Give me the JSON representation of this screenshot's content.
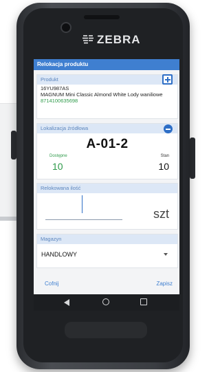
{
  "brand": {
    "logo_text": "ZEBRA"
  },
  "app": {
    "title": "Relokacja produktu"
  },
  "product": {
    "header": "Produkt",
    "code": "16YU987AS",
    "name": "MAGNUM Mini Classic Almond White Lody waniliowe",
    "ean": "8714100635698",
    "add_icon": "plus-square-icon"
  },
  "source_location": {
    "header": "Lokalizacja źródłowa",
    "code": "A-01-2",
    "available_label": "Dostępne",
    "available_value": "10",
    "stock_label": "Stan",
    "stock_value": "10",
    "collapse_icon": "minus-circle-icon"
  },
  "quantity": {
    "header": "Relokowana ilość",
    "value": "",
    "unit": "szt"
  },
  "warehouse": {
    "header": "Magazyn",
    "selected": "HANDLOWY"
  },
  "actions": {
    "back_label": "Cofnij",
    "save_label": "Zapisz"
  },
  "colors": {
    "accent": "#3f7fd0",
    "green": "#2e9a4a",
    "header_bg": "#dce7f6"
  }
}
